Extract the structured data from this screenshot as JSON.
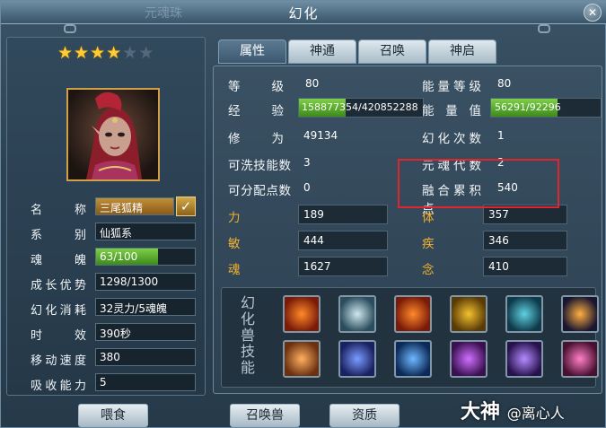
{
  "window": {
    "ghost_title": "元魂珠",
    "title": "幻化",
    "close_symbol": "✕"
  },
  "rating": {
    "filled": 4,
    "total": 6
  },
  "left": {
    "name_label": "名称",
    "name_value": "三尾狐精",
    "series_label": "系别",
    "series_value": "仙狐系",
    "soul_label": "魂魄",
    "soul_value": "63/100",
    "soul_progress": 0.63,
    "growth_label": "成长优势",
    "growth_value": "1298/1300",
    "cost_label": "幻化消耗",
    "cost_value": "32灵力/5魂魄",
    "duration_label": "时效",
    "duration_value": "390秒",
    "speed_label": "移动速度",
    "speed_value": "380",
    "absorb_label": "吸收能力",
    "absorb_value": "5"
  },
  "tabs": [
    "属性",
    "神通",
    "召唤",
    "神启"
  ],
  "stats": {
    "level_label": "等级",
    "level_value": "80",
    "energy_level_label": "能量等级",
    "energy_level_value": "80",
    "exp_label": "经验",
    "exp_value": "158877354/420852288",
    "exp_progress": 0.3775,
    "energy_label": "能量值",
    "energy_value": "56291/92296",
    "energy_progress": 0.61,
    "cultivation_label": "修为",
    "cultivation_value": "49134",
    "transform_count_label": "幻化次数",
    "transform_count_value": "1",
    "washable_label": "可洗技能数",
    "washable_value": "3",
    "soul_gen_label": "元魂代数",
    "soul_gen_value": "2",
    "free_points_label": "可分配点数",
    "free_points_value": "0",
    "fusion_label": "融合累积点",
    "fusion_value": "540",
    "str_label": "力",
    "str_value": "189",
    "con_label": "体",
    "con_value": "357",
    "agi_label": "敏",
    "agi_value": "444",
    "spd_label": "疾",
    "spd_value": "346",
    "soul_attr_label": "魂",
    "soul_attr_value": "1627",
    "mind_label": "念",
    "mind_value": "410"
  },
  "skills": {
    "label": "幻化兽技能",
    "icons": [
      "fire-swirl-icon",
      "wind-vortex-icon",
      "fire-swirl-icon",
      "golden-dragon-icon",
      "water-ring-icon",
      "meteor-icon",
      "orange-rune-icon",
      "blue-rune-icon",
      "blue-shield-rune-icon",
      "purple-rune-icon",
      "violet-shield-icon",
      "pink-rune-icon"
    ]
  },
  "buttons": {
    "feed": "喂食",
    "summon": "召唤兽",
    "qualification": "资质"
  },
  "watermark": {
    "brand": "大神",
    "user": "@离心人"
  }
}
